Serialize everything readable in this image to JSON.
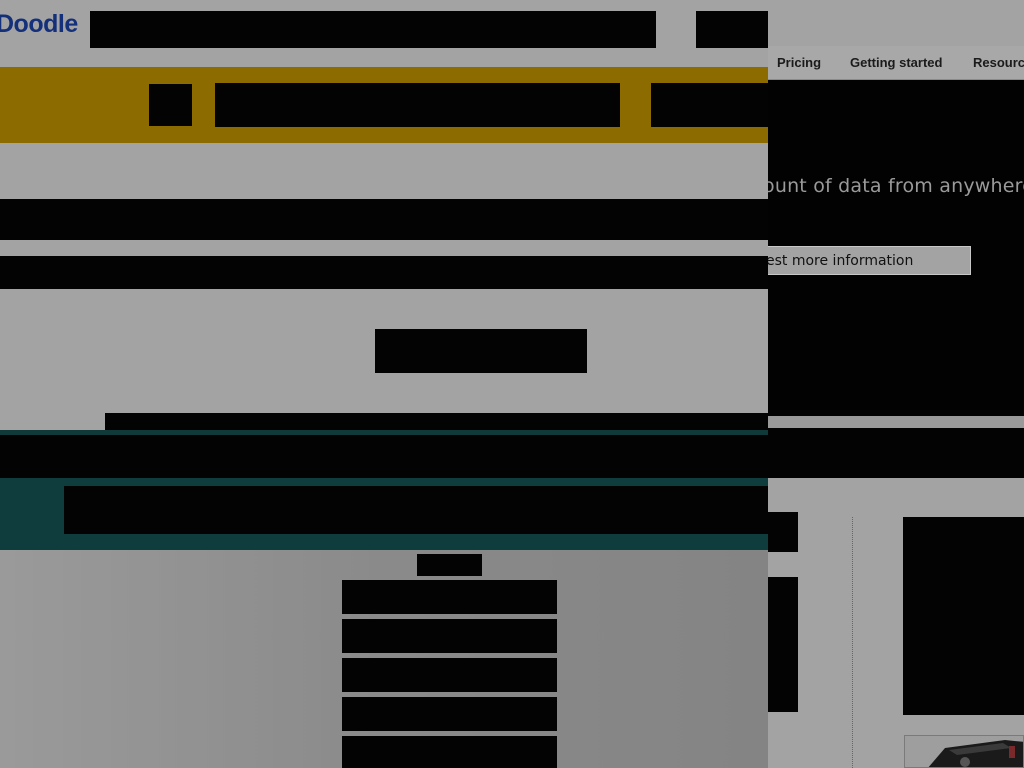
{
  "brand": {
    "logo_text": "Doodle"
  },
  "nav": {
    "items": [
      {
        "label": "Pricing"
      },
      {
        "label": "Getting started"
      },
      {
        "label": "Resources"
      }
    ]
  },
  "hero": {
    "tagline": "ount of data from anywhere",
    "cta_label": "est more information"
  },
  "colors": {
    "gold": "#8c6b00",
    "teal": "#0f3c3c",
    "redaction": "#030303",
    "brand_blue": "#14307a"
  }
}
